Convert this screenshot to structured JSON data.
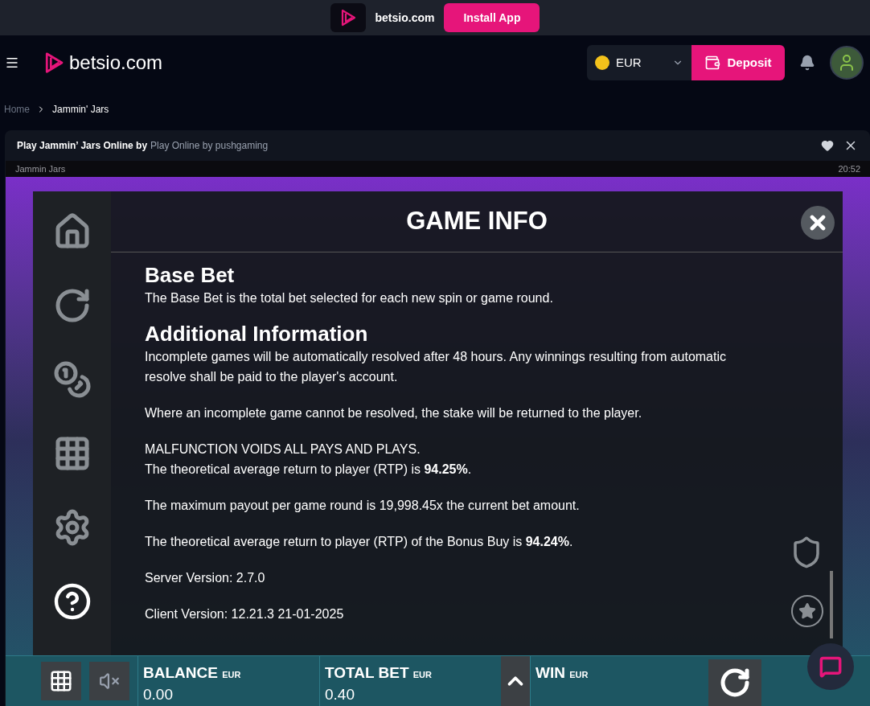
{
  "banner": {
    "site": "betsio.com",
    "button": "Install App"
  },
  "header": {
    "logo": "betsio.com",
    "currency": "EUR",
    "deposit": "Deposit"
  },
  "breadcrumb": [
    {
      "label": "Home"
    },
    {
      "label": "Jammin' Jars"
    }
  ],
  "game_card": {
    "title": "Play Jammin’ Jars Online by",
    "subtitle": "Play Online by pushgaming",
    "frame_label": "Jammin Jars",
    "time": "20:52"
  },
  "game_info": {
    "title": "GAME INFO",
    "sections": [
      {
        "heading": "Base Bet",
        "paragraphs": [
          "The Base Bet is the total bet selected for each new spin or game round."
        ]
      },
      {
        "heading": "Additional Information",
        "paragraphs": [
          "Incomplete games will be automatically resolved after 48 hours. Any winnings resulting from automatic resolve shall be paid to the player's account.",
          "Where an incomplete game cannot be resolved, the stake will be returned to the player.",
          "MALFUNCTION VOIDS ALL PAYS AND PLAYS.\nThe theoretical average return to player (RTP) is **94.25%**.",
          "The maximum payout per game round is 19,998.45x the current bet amount.",
          "The theoretical average return to player (RTP) of the Bonus Buy is **94.24%**.",
          "Server Version: 2.7.0",
          "Client Version: 12.21.3 21-01-2025"
        ]
      }
    ],
    "sidebar": [
      {
        "kind": "home",
        "selected": false
      },
      {
        "kind": "replay",
        "selected": false
      },
      {
        "kind": "coins",
        "selected": false
      },
      {
        "kind": "grid",
        "selected": false
      },
      {
        "kind": "settings",
        "selected": false
      },
      {
        "kind": "help",
        "selected": true
      }
    ]
  },
  "bottom_bar": {
    "fields": [
      {
        "label": "BALANCE",
        "unit": "EUR",
        "value": "0.00"
      },
      {
        "label": "TOTAL BET",
        "unit": "EUR",
        "value": "0.40"
      },
      {
        "label": "WIN",
        "unit": "EUR"
      }
    ]
  }
}
